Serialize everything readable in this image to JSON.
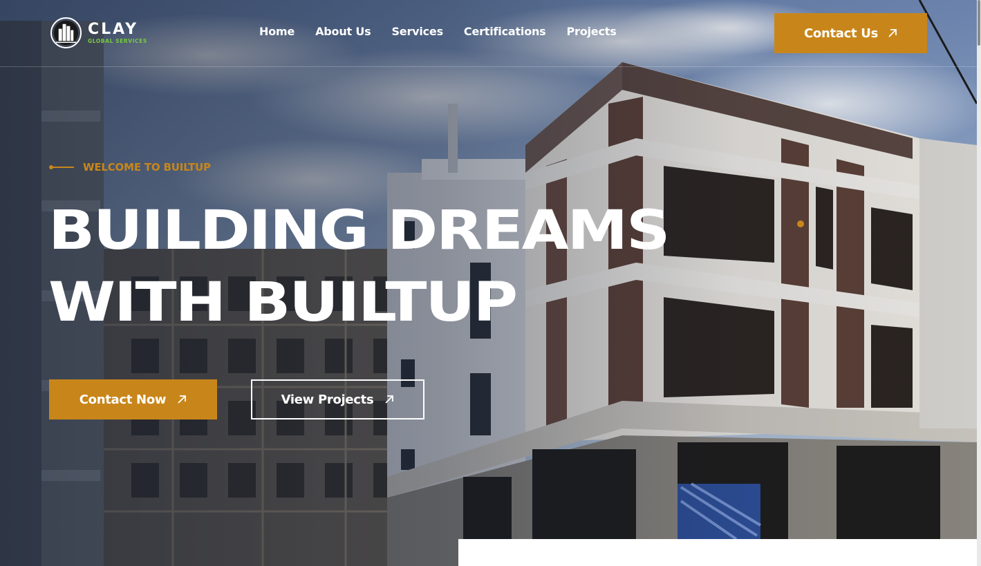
{
  "brand": {
    "name": "CLAY",
    "tagline": "GLOBAL SERVICES",
    "accent_color": "#c8861a",
    "tagline_color": "#7ac943"
  },
  "nav": {
    "items": [
      {
        "label": "Home"
      },
      {
        "label": "About Us"
      },
      {
        "label": "Services"
      },
      {
        "label": "Certifications"
      },
      {
        "label": "Projects"
      }
    ],
    "contact_button": {
      "label": "Contact Us",
      "icon": "arrow-up-right-icon"
    }
  },
  "hero": {
    "eyebrow": "WELCOME TO BUILTUP",
    "title_lines": [
      "BUILDING DREAMS",
      "WITH BUILTUP"
    ],
    "primary_button": {
      "label": "Contact Now",
      "icon": "arrow-up-right-icon"
    },
    "secondary_button": {
      "label": "View Projects",
      "icon": "arrow-up-right-icon"
    }
  },
  "slider": {
    "active_index": 0
  }
}
